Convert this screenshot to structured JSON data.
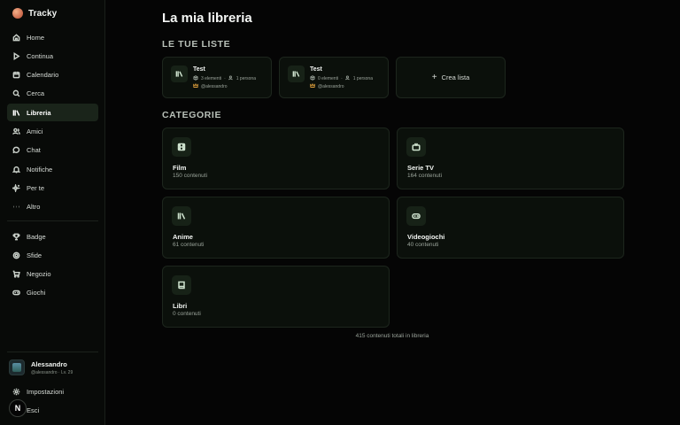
{
  "app": {
    "name": "Tracky",
    "accent": "#1a241a"
  },
  "sidebar": {
    "main_items": [
      {
        "label": "Home",
        "icon": "home-icon"
      },
      {
        "label": "Continua",
        "icon": "play-icon"
      },
      {
        "label": "Calendario",
        "icon": "calendar-icon"
      },
      {
        "label": "Cerca",
        "icon": "search-icon"
      },
      {
        "label": "Libreria",
        "icon": "library-icon",
        "active": true
      },
      {
        "label": "Amici",
        "icon": "users-icon"
      },
      {
        "label": "Chat",
        "icon": "chat-icon"
      },
      {
        "label": "Notifiche",
        "icon": "bell-icon"
      },
      {
        "label": "Per te",
        "icon": "sparkles-icon"
      },
      {
        "label": "Altro",
        "icon": "more-icon"
      }
    ],
    "extra_items": [
      {
        "label": "Badge",
        "icon": "trophy-icon"
      },
      {
        "label": "Sfide",
        "icon": "target-icon"
      },
      {
        "label": "Negozio",
        "icon": "cart-icon"
      },
      {
        "label": "Giochi",
        "icon": "gamepad-icon"
      }
    ],
    "user": {
      "name": "Alessandro",
      "meta": "@alessandro · Lv. 29"
    },
    "bottom_items": [
      {
        "label": "Impostazioni",
        "icon": "gear-icon"
      },
      {
        "label": "Esci",
        "icon": "logout-icon"
      }
    ],
    "n_badge": "N"
  },
  "main": {
    "title": "La mia libreria",
    "lists_section": "LE TUE LISTE",
    "lists": [
      {
        "name": "Test",
        "items": "3 elementi",
        "members": "1 persona",
        "owner": "@alessandro"
      },
      {
        "name": "Test",
        "items": "0 elementi",
        "members": "1 persona",
        "owner": "@alessandro"
      }
    ],
    "create_list_label": "Crea lista",
    "categories_section": "CATEGORIE",
    "categories": [
      {
        "name": "Film",
        "count": "150 contenuti",
        "icon": "film-icon"
      },
      {
        "name": "Serie TV",
        "count": "164 contenuti",
        "icon": "tv-icon"
      },
      {
        "name": "Anime",
        "count": "61 contenuti",
        "icon": "library-icon"
      },
      {
        "name": "Videogiochi",
        "count": "40 contenuti",
        "icon": "gamepad-icon"
      },
      {
        "name": "Libri",
        "count": "0 contenuti",
        "icon": "book-icon"
      }
    ],
    "total": "415 contenuti totali in libreria"
  }
}
